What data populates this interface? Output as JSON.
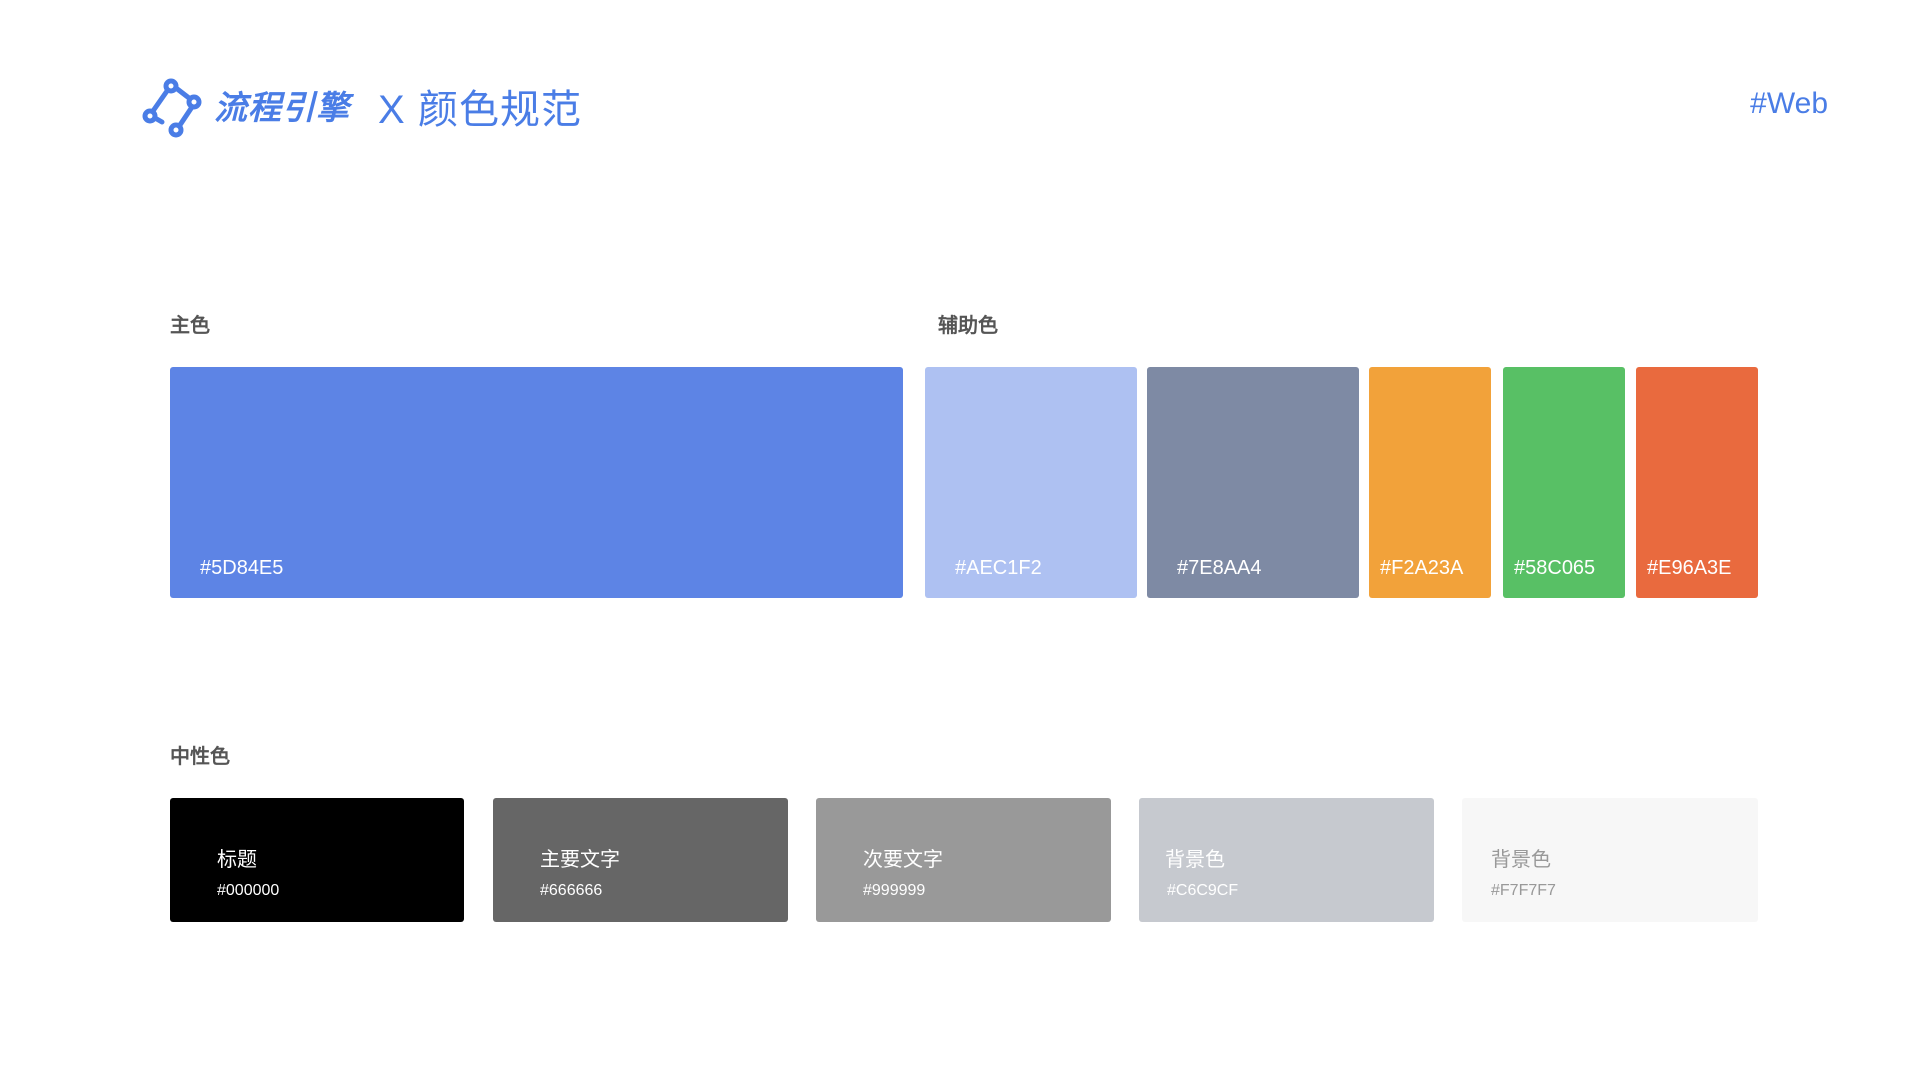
{
  "header": {
    "brand": "流程引擎",
    "separator": "X",
    "title": "颜色规范",
    "platform": "#Web",
    "accent_color": "#4a7de6",
    "logo_icon": "flow-nodes-icon"
  },
  "primary": {
    "label": "主色",
    "swatch": {
      "color": "#5D84E5",
      "code": "#5D84E5"
    }
  },
  "secondary": {
    "label": "辅助色",
    "swatches": [
      {
        "color": "#AEC1F2",
        "code": "#AEC1F2"
      },
      {
        "color": "#7E8AA4",
        "code": "#7E8AA4"
      },
      {
        "color": "#F2A23A",
        "code": "#F2A23A"
      },
      {
        "color": "#58C065",
        "code": "#58C065"
      },
      {
        "color": "#E96A3E",
        "code": "#E96A3E"
      }
    ]
  },
  "neutral": {
    "label": "中性色",
    "swatches": [
      {
        "name": "标题",
        "code": "#000000",
        "color": "#000000",
        "text_color": "#ffffff"
      },
      {
        "name": "主要文字",
        "code": "#666666",
        "color": "#666666",
        "text_color": "#ffffff"
      },
      {
        "name": "次要文字",
        "code": "#999999",
        "color": "#999999",
        "text_color": "#ffffff"
      },
      {
        "name": "背景色",
        "code": "#C6C9CF",
        "color": "#C6C9CF",
        "text_color": "#ffffff"
      },
      {
        "name": "背景色",
        "code": "#F7F7F7",
        "color": "#F7F7F7",
        "text_color": "#999999"
      }
    ]
  }
}
